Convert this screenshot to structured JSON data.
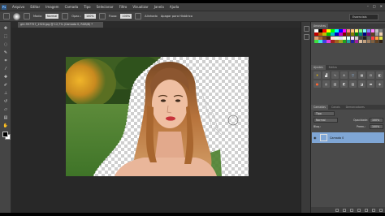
{
  "app": {
    "menu": [
      "Arquivo",
      "Editar",
      "Imagem",
      "Camada",
      "Tipo",
      "Selecionar",
      "Filtro",
      "Visualizar",
      "Janela",
      "Ajuda"
    ],
    "window_controls": [
      "–",
      "□",
      "✕"
    ]
  },
  "options_bar": {
    "mode_label": "Modo:",
    "mode_value": "Normal",
    "opacity_label": "Opac.:",
    "opacity_value": "100%",
    "flow_label": "Fluxo:",
    "flow_value": "100%",
    "align_label": "Alinhado",
    "sample_label": "Apagar para Histórico",
    "workspace_value": "Essenciais"
  },
  "document": {
    "tab_title": "girl-997757_1920.jpg @ 12,7% (Camada 0, RGB/8) *"
  },
  "panels": {
    "color_tabs": [
      "Amostras"
    ],
    "adjust_tabs": [
      "Ajustes",
      "Estilos"
    ],
    "layer_tabs": [
      "Camadas",
      "Canais",
      "Demarcadores"
    ],
    "filter_label": "Tipo",
    "blend_mode": "Normal",
    "opacity_label": "Opacidade:",
    "opacity_value": "100%",
    "lock_label": "Bloq.:",
    "fill_label": "Preen.:",
    "fill_value": "100%",
    "layer_name": "Camada 0",
    "swatch_colors": [
      "#ffffff",
      "#000000",
      "#ff0000",
      "#ffff00",
      "#00ff00",
      "#00ffff",
      "#0000ff",
      "#ff00ff",
      "#ff8080",
      "#ffc080",
      "#fff080",
      "#80ff80",
      "#80ffff",
      "#8080ff",
      "#ff80ff",
      "#c0c0c0",
      "#808080",
      "#c00000",
      "#c06000",
      "#c0c000",
      "#00c000",
      "#00c0c0",
      "#0000c0",
      "#c000c0",
      "#800000",
      "#804000",
      "#808000",
      "#008000",
      "#008080",
      "#000080",
      "#800080",
      "#604020",
      "#a0a0a0",
      "#f0d0b0",
      "#e0a070",
      "#b06030",
      "#704020",
      "#402010",
      "#ffe0e0",
      "#e0ffe0",
      "#e0e0ff",
      "#ffffe0",
      "#e0ffff",
      "#ffe0ff",
      "#d0d0d0",
      "#404040",
      "#202020",
      "#606060",
      "#ff4040",
      "#ffa040",
      "#e0e040",
      "#40e040",
      "#40e0e0",
      "#4040e0",
      "#e040e0",
      "#a02020",
      "#a06020",
      "#a0a020",
      "#20a020",
      "#20a0a0",
      "#2020a0",
      "#a020a0",
      "#e0c0a0",
      "#c0a080",
      "#a08060",
      "#806040",
      "#604020",
      "#302010"
    ]
  }
}
